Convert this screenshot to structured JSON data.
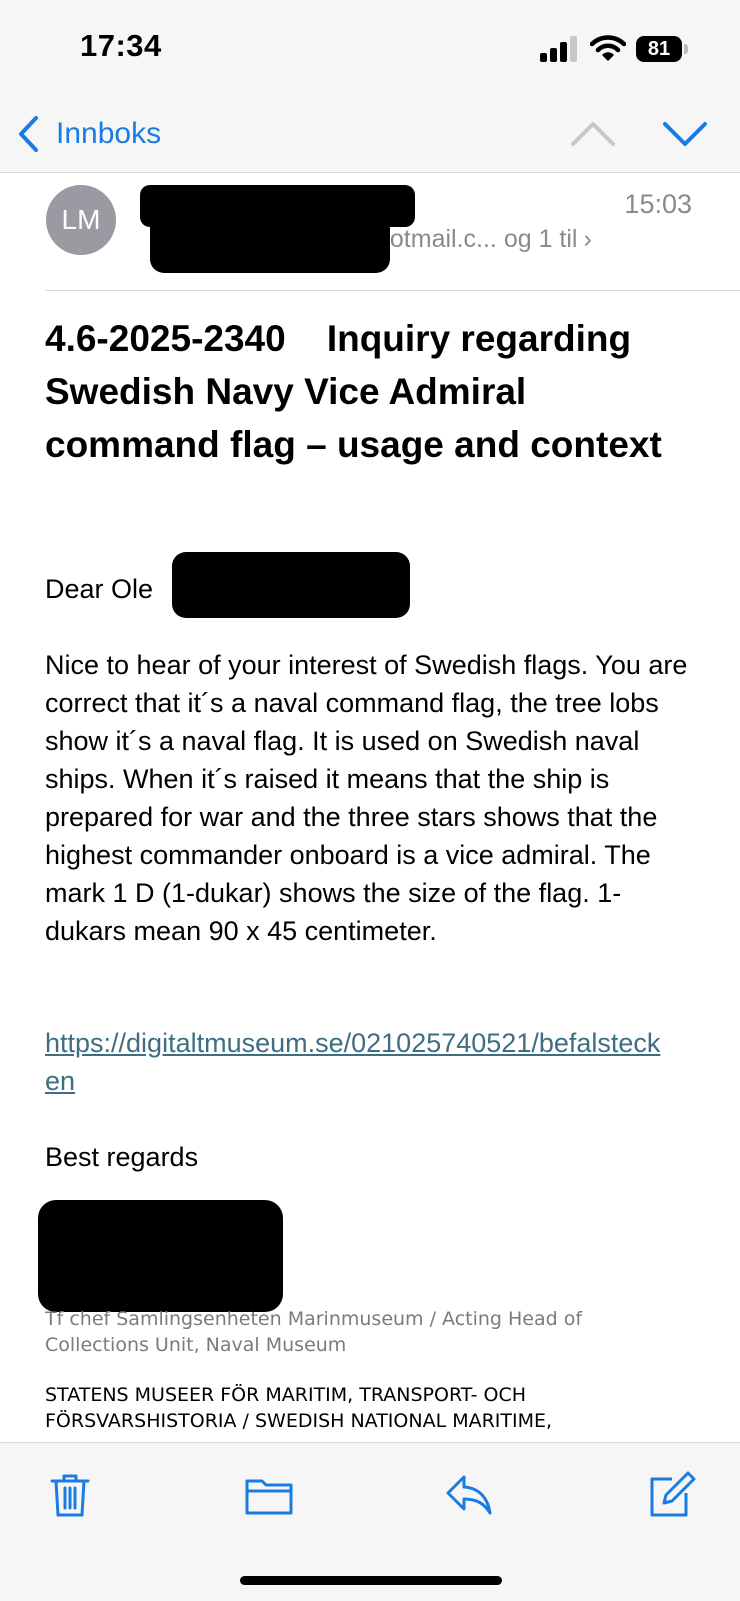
{
  "status_bar": {
    "time": "17:34",
    "battery": "81"
  },
  "nav": {
    "back_label": "Innboks"
  },
  "message": {
    "avatar_initials": "LM",
    "recipients_visible": "hotmail.c... og 1 til",
    "time": "15:03",
    "subject": "4.6-2025-2340    Inquiry regarding Swedish Navy Vice Admiral command flag – usage and context",
    "greeting": "Dear Ole",
    "body": "Nice to hear of your interest of Swedish flags. You are correct that it´s a naval command flag, the tree lobs show it´s a naval flag. It is used on Swedish naval ships. When it´s raised it means that the ship is prepared for war and the three stars shows that the highest commander onboard is a vice admiral. The mark 1 D (1-dukar) shows the size of the flag. 1-dukars mean 90 x 45 centimeter.",
    "link": "https://digitaltmuseum.se/021025740521/befalstecken",
    "closing": "Best regards",
    "signature_role": "Tf chef Samlingsenheten Marinmuseum / Acting Head of Collections Unit, Naval Museum",
    "signature_org": "STATENS MUSEER FÖR MARITIM, TRANSPORT- OCH FÖRSVARSHISTORIA / SWEDISH NATIONAL MARITIME,"
  },
  "colors": {
    "accent": "#1a7ce3",
    "link": "#3e6e82",
    "secondary_text": "#8a8a8e"
  },
  "icons": {
    "back": "chevron-left-icon",
    "prev": "chevron-up-icon",
    "next": "chevron-down-icon",
    "delete": "trash-icon",
    "move": "folder-icon",
    "reply": "reply-icon",
    "compose": "compose-icon"
  }
}
